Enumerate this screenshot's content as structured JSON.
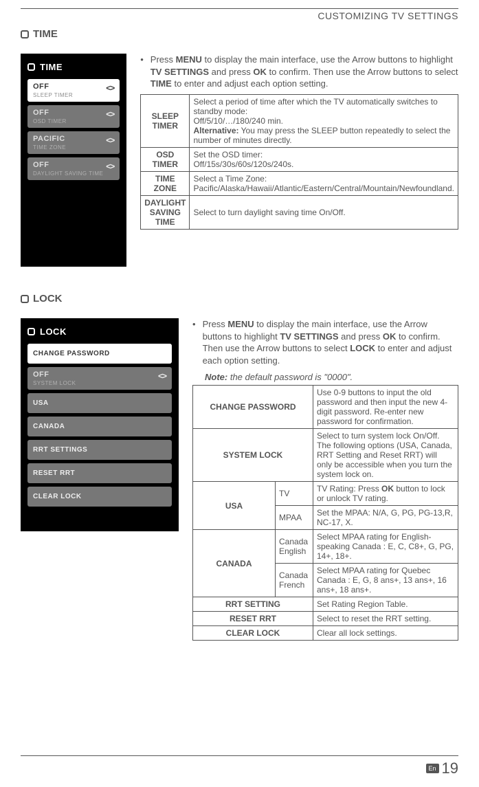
{
  "header": "CUSTOMIZING TV SETTINGS",
  "time": {
    "heading": "TIME",
    "screenshot": {
      "title": "TIME",
      "items": [
        {
          "val": "OFF",
          "lbl": "SLEEP TIMER",
          "chev": "<>",
          "style": "white"
        },
        {
          "val": "OFF",
          "lbl": "OSD TIMER",
          "chev": "<>",
          "style": "gray"
        },
        {
          "val": "PACIFIC",
          "lbl": "TIME ZONE",
          "chev": "<>",
          "style": "gray"
        },
        {
          "val": "OFF",
          "lbl": "DAYLIGHT SAVING TIME",
          "chev": "<>",
          "style": "gray"
        }
      ]
    },
    "intro": {
      "pre1": "Press ",
      "b1": "MENU",
      "mid1": " to display the main interface, use the Arrow buttons to highlight ",
      "b2": "TV SETTINGS",
      "mid2": " and press ",
      "b3": "OK",
      "mid3": " to confirm. Then use the Arrow buttons to select ",
      "b4": "TIME",
      "post": " to enter and adjust each option setting."
    },
    "table": {
      "r1": {
        "label": "SLEEP TIMER",
        "t1": "Select a period of time after which the TV automatically switches to standby mode:",
        "t2": "Off/5/10/…/180/240 min.",
        "altb": "Alternative:",
        "alt": " You may press the SLEEP button repeatedly to select the number of minutes directly."
      },
      "r2": {
        "label": "OSD TIMER",
        "t1": "Set the OSD timer:",
        "t2": "Off/15s/30s/60s/120s/240s."
      },
      "r3": {
        "label": "TIME ZONE",
        "t1": "Select a Time Zone:",
        "t2": "Pacific/Alaska/Hawaii/Atlantic/Eastern/Central/Mountain/Newfoundland."
      },
      "r4": {
        "label": "DAYLIGHT SAVING TIME",
        "text": "Select to turn daylight saving time On/Off."
      }
    }
  },
  "lock": {
    "heading": "LOCK",
    "screenshot": {
      "title": "LOCK",
      "items": [
        {
          "val": "CHANGE PASSWORD",
          "style": "white-single"
        },
        {
          "val": "OFF",
          "lbl": "SYSTEM LOCK",
          "chev": "<>",
          "style": "gray"
        },
        {
          "val": "USA",
          "style": "gray-single"
        },
        {
          "val": "CANADA",
          "style": "gray-single"
        },
        {
          "val": "RRT SETTINGS",
          "style": "gray-single"
        },
        {
          "val": "RESET RRT",
          "style": "gray-single"
        },
        {
          "val": "CLEAR LOCK",
          "style": "gray-single"
        }
      ]
    },
    "intro": {
      "pre1": "Press ",
      "b1": "MENU",
      "mid1": " to display the main interface, use the Arrow buttons to highlight ",
      "b2": "TV SETTINGS",
      "mid2": " and press ",
      "b3": "OK",
      "mid3": " to confirm. Then use the Arrow buttons to select ",
      "b4": "LOCK",
      "post": " to enter and adjust each option setting."
    },
    "note": {
      "label": "Note:",
      "text": " the default password is \"0000\"."
    },
    "table": {
      "r1": {
        "label": "CHANGE PASSWORD",
        "text": "Use 0-9 buttons to input the old password and then input the new 4-digit password. Re-enter new password for confirmation."
      },
      "r2": {
        "label": "SYSTEM LOCK",
        "text": "Select to turn system lock On/Off. The following options (USA, Canada, RRT Setting and Reset RRT) will only be accessible when you turn the system lock on."
      },
      "r3": {
        "label": "USA",
        "sub1": {
          "label": "TV",
          "t1": "TV Rating: Press ",
          "b": "OK",
          "t2": " button to lock or unlock TV rating."
        },
        "sub2": {
          "label": "MPAA",
          "text": "Set the MPAA: N/A, G, PG, PG-13,R, NC-17, X."
        }
      },
      "r4": {
        "label": "CANADA",
        "sub1": {
          "label": "Canada English",
          "text": "Select MPAA rating for English-speaking Canada : E, C, C8+, G, PG, 14+, 18+."
        },
        "sub2": {
          "label": "Canada French",
          "text": "Select MPAA rating for Quebec Canada : E, G, 8 ans+, 13 ans+, 16 ans+, 18 ans+."
        }
      },
      "r5": {
        "label": "RRT SETTING",
        "text": "Set Rating Region Table."
      },
      "r6": {
        "label": "RESET RRT",
        "text": "Select to reset the RRT setting."
      },
      "r7": {
        "label": "CLEAR LOCK",
        "text": "Clear all lock settings."
      }
    }
  },
  "footer": {
    "lang": "En",
    "page": "19"
  }
}
